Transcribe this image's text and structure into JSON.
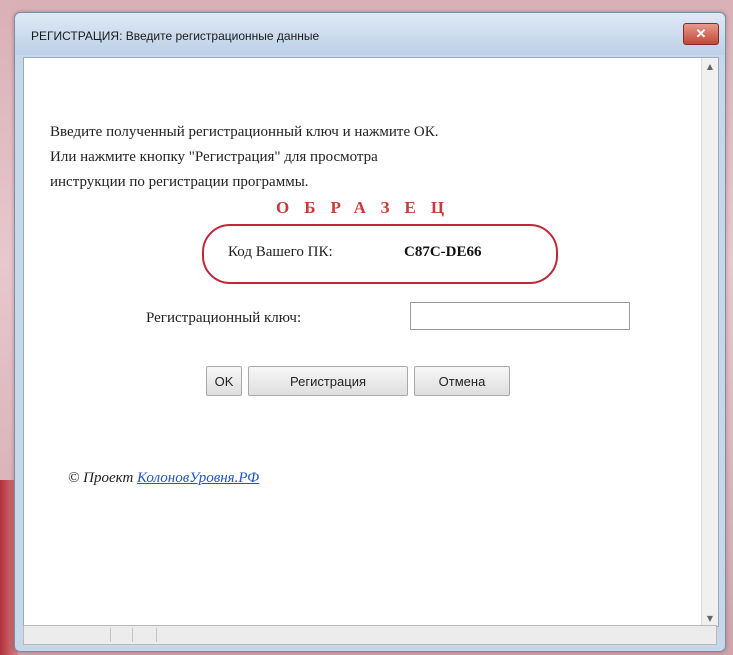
{
  "window": {
    "title": "РЕГИСТРАЦИЯ: Введите регистрационные данные",
    "close_glyph": "✕"
  },
  "body": {
    "intro_lines": [
      "Введите полученный регистрационный ключ и нажмите ОК.",
      "Или нажмите кнопку \"Регистрация\" для просмотра",
      "инструкции по регистрации программы."
    ],
    "sample_stamp": "ОБРАЗЕЦ",
    "pc_code_label": "Код Вашего ПК:",
    "pc_code_value": "C87C-DE66",
    "key_label": "Регистрационный ключ:",
    "key_value": "",
    "key_placeholder": ""
  },
  "buttons": {
    "ok": "OK",
    "register": "Регистрация",
    "cancel": "Отмена"
  },
  "footer": {
    "prefix": "© Проект",
    "link_text": "КолоновУровня.РФ"
  },
  "scrollbar": {
    "up_arrow": "▲",
    "down_arrow": "▼"
  },
  "colors": {
    "stamp_red": "#c93a3a",
    "oval_red": "#c0283a",
    "link_blue": "#1f56c9"
  }
}
